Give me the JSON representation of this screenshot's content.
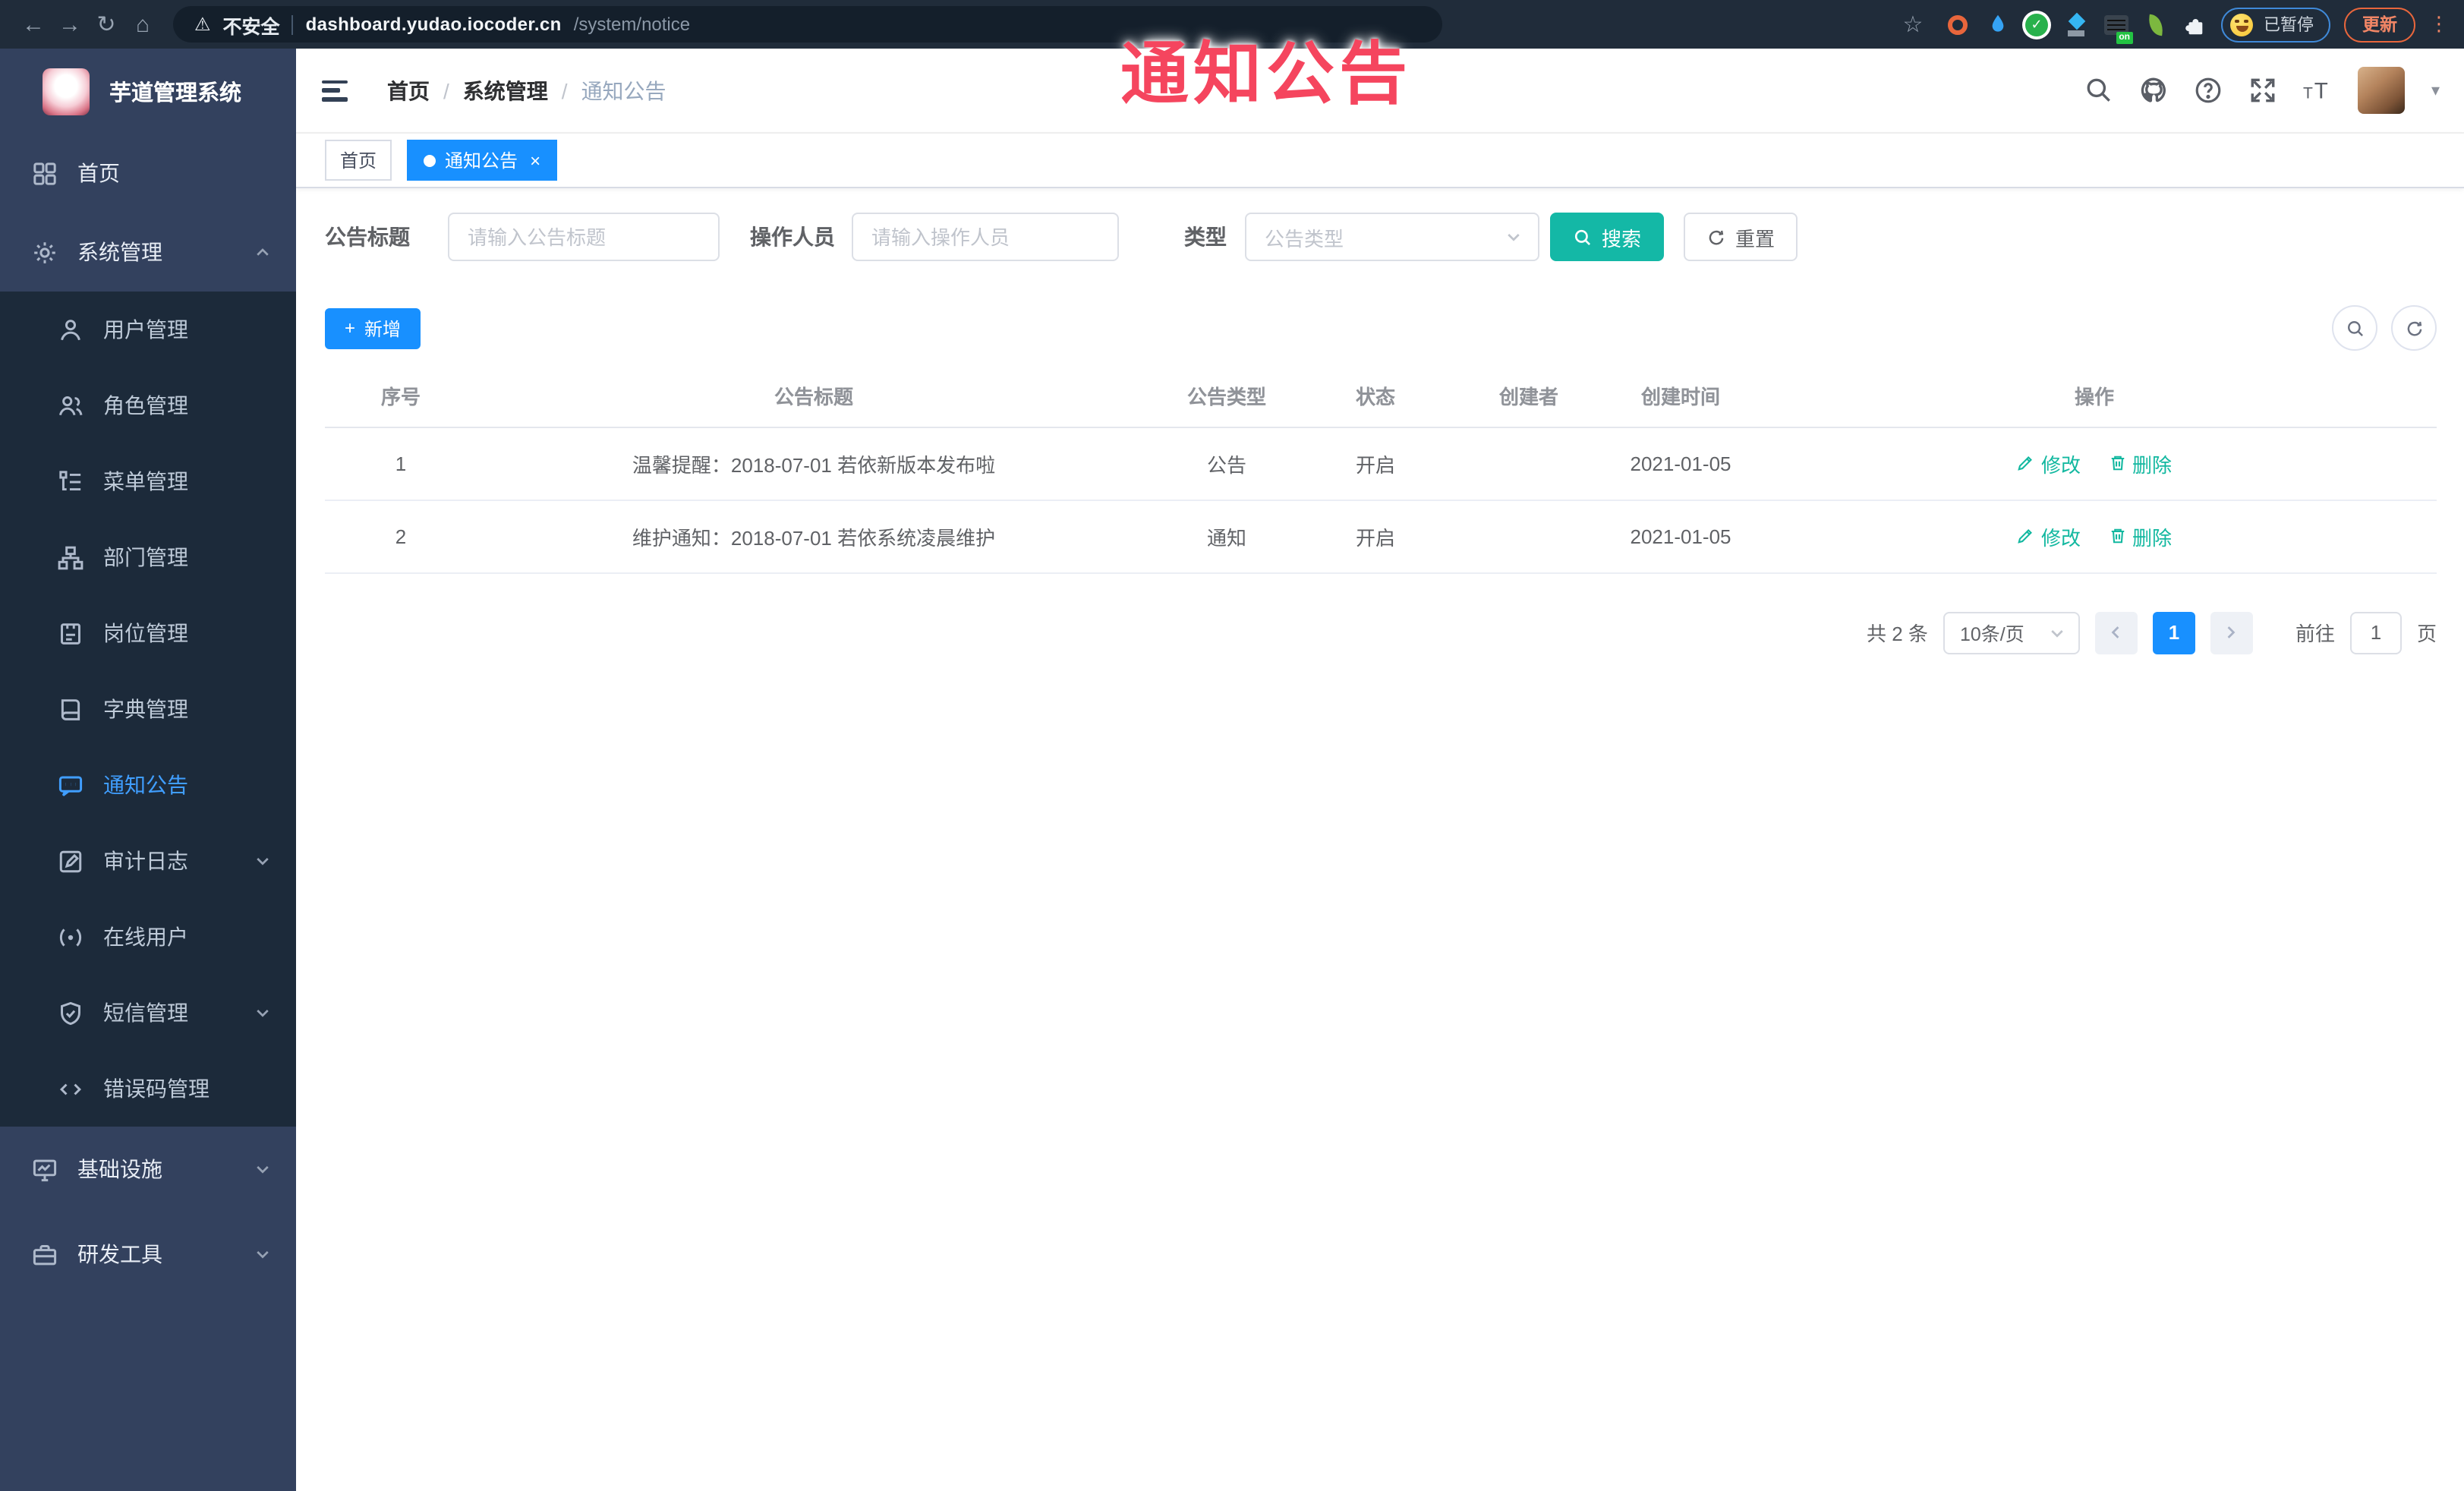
{
  "browser": {
    "security_label": "不安全",
    "url_host": "dashboard.yudao.iocoder.cn",
    "url_path": "/system/notice",
    "extension_on_badge": "on",
    "paused_label": "已暂停",
    "update_label": "更新"
  },
  "annotation": {
    "title": "通知公告",
    "color": "#f5455e"
  },
  "sidebar": {
    "app_title": "芋道管理系统",
    "items": [
      {
        "label": "首页",
        "icon": "dashboard-icon"
      },
      {
        "label": "系统管理",
        "icon": "gear-icon"
      },
      {
        "label": "用户管理",
        "icon": "user-icon"
      },
      {
        "label": "角色管理",
        "icon": "users-icon"
      },
      {
        "label": "菜单管理",
        "icon": "menu-tree-icon"
      },
      {
        "label": "部门管理",
        "icon": "org-tree-icon"
      },
      {
        "label": "岗位管理",
        "icon": "badge-icon"
      },
      {
        "label": "字典管理",
        "icon": "book-icon"
      },
      {
        "label": "通知公告",
        "icon": "megaphone-icon",
        "active": true
      },
      {
        "label": "审计日志",
        "icon": "log-icon"
      },
      {
        "label": "在线用户",
        "icon": "online-icon"
      },
      {
        "label": "短信管理",
        "icon": "shield-icon"
      },
      {
        "label": "错误码管理",
        "icon": "code-icon"
      },
      {
        "label": "基础设施",
        "icon": "monitor-icon"
      },
      {
        "label": "研发工具",
        "icon": "toolbox-icon"
      }
    ]
  },
  "header": {
    "breadcrumb": {
      "home": "首页",
      "separator": "/",
      "section": "系统管理",
      "current": "通知公告"
    }
  },
  "tabs": {
    "home": "首页",
    "current": "通知公告"
  },
  "filters": {
    "title_label": "公告标题",
    "title_placeholder": "请输入公告标题",
    "operator_label": "操作人员",
    "operator_placeholder": "请输入操作人员",
    "type_label": "类型",
    "type_placeholder": "公告类型",
    "search_label": "搜索",
    "reset_label": "重置"
  },
  "toolbar": {
    "add_label": "新增"
  },
  "table": {
    "columns": {
      "no": "序号",
      "title": "公告标题",
      "type": "公告类型",
      "status": "状态",
      "creator": "创建者",
      "created": "创建时间",
      "actions": "操作"
    },
    "rows": [
      {
        "no": "1",
        "title": "温馨提醒：2018-07-01 若依新版本发布啦",
        "type": "公告",
        "status": "开启",
        "creator": "",
        "created": "2021-01-05",
        "edit": "修改",
        "del": "删除"
      },
      {
        "no": "2",
        "title": "维护通知：2018-07-01 若依系统凌晨维护",
        "type": "通知",
        "status": "开启",
        "creator": "",
        "created": "2021-01-05",
        "edit": "修改",
        "del": "删除"
      }
    ]
  },
  "pagination": {
    "total": "共 2 条",
    "page_size": "10条/页",
    "page": "1",
    "goto_label": "前往",
    "goto_value": "1",
    "unit_label": "页"
  },
  "colors": {
    "primary_blue": "#1890ff",
    "search_teal": "#14b8a6",
    "action_teal": "#13b8a0",
    "active_menu_blue": "#409eff",
    "sidebar_bg": "#33415e",
    "submenu_bg": "#1c2a3a",
    "annotation_red": "#f5455e"
  }
}
